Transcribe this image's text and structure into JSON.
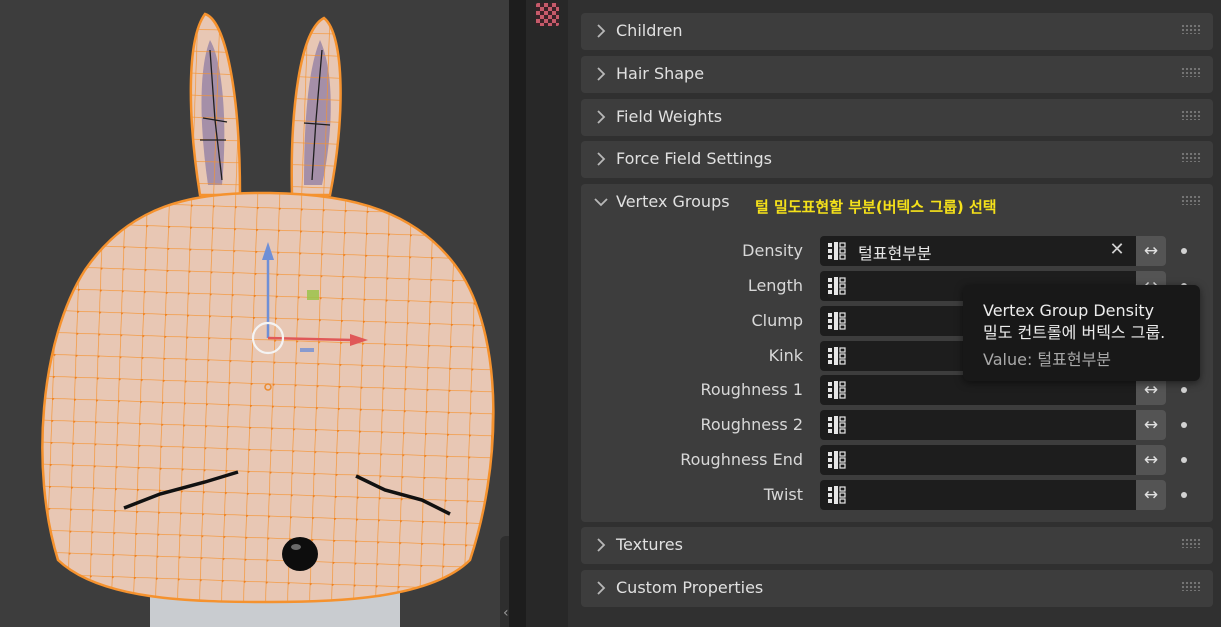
{
  "panels": {
    "children": "Children",
    "hair_shape": "Hair Shape",
    "field_weights": "Field Weights",
    "force_field_settings": "Force Field Settings",
    "vertex_groups": "Vertex Groups",
    "textures": "Textures",
    "custom_properties": "Custom Properties"
  },
  "annotation": "털 밀도표현할 부분(버텍스 그룹) 선택",
  "vertex_groups": {
    "rows": [
      {
        "label": "Density",
        "value": "털표현부분"
      },
      {
        "label": "Length",
        "value": ""
      },
      {
        "label": "Clump",
        "value": ""
      },
      {
        "label": "Kink",
        "value": ""
      },
      {
        "label": "Roughness 1",
        "value": ""
      },
      {
        "label": "Roughness 2",
        "value": ""
      },
      {
        "label": "Roughness End",
        "value": ""
      },
      {
        "label": "Twist",
        "value": ""
      }
    ],
    "clear_glyph": "✕",
    "invert_glyph": "↔"
  },
  "tooltip": {
    "title": "Vertex Group Density",
    "description": "밀도 컨트롤에 버텍스 그룹.",
    "value": "Value: 털표현부분"
  },
  "viewport": {
    "edge_tab_glyph": "‹"
  },
  "icons": {
    "texture_tab": "checker-texture-icon",
    "vertex_group": "vertex-group-icon",
    "collapse": "chevron-right-icon",
    "expand": "chevron-down-icon"
  },
  "colors": {
    "selection_orange": "#f5922e",
    "annotation_yellow": "#f5e11a",
    "panel_bg": "#3d3d3d",
    "field_bg": "#1d1d1d",
    "mesh_skin": "#e8c7b4"
  }
}
